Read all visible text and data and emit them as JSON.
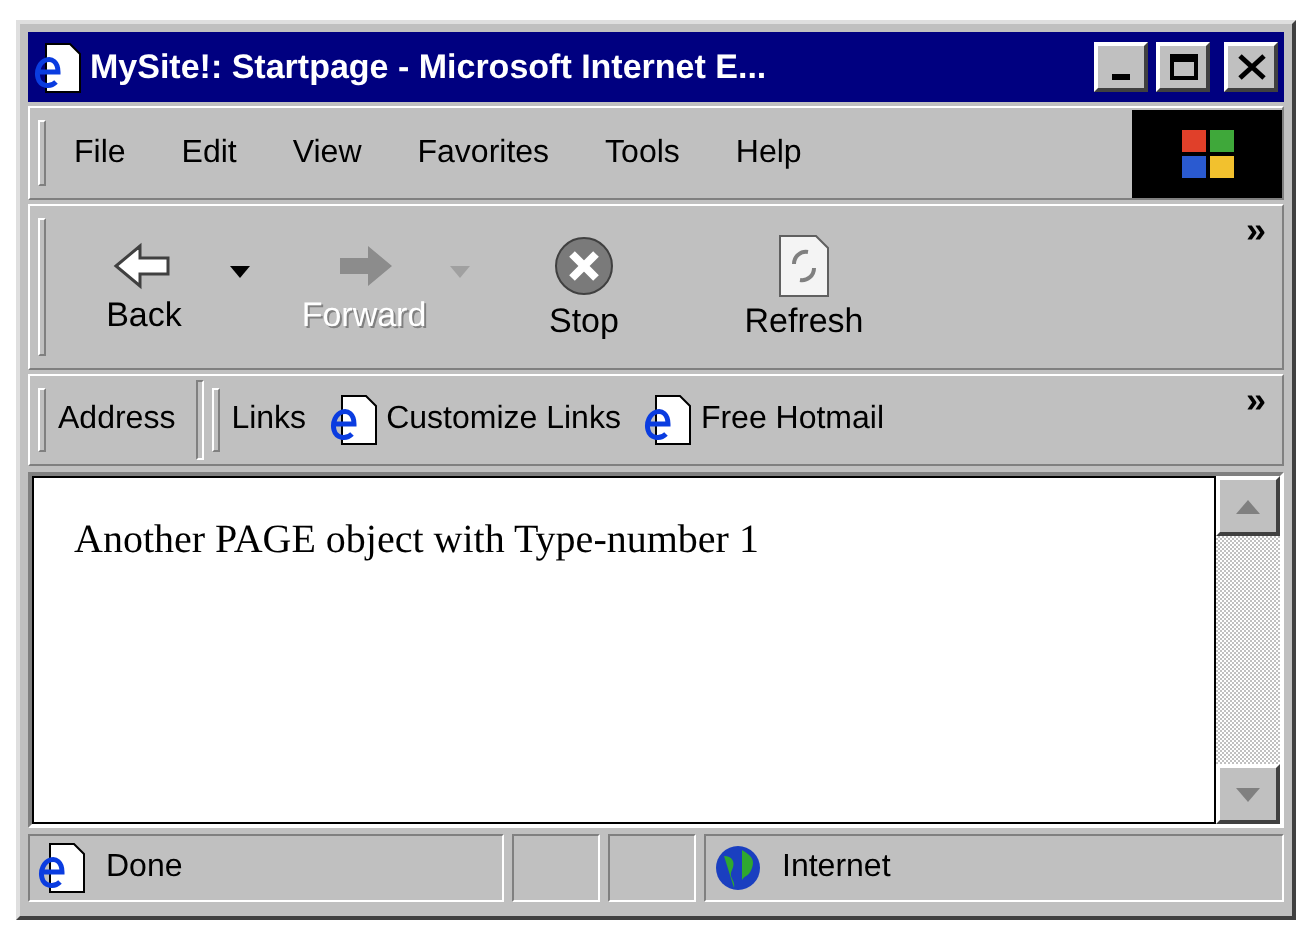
{
  "window": {
    "title": "MySite!: Startpage - Microsoft Internet E..."
  },
  "menu": [
    "File",
    "Edit",
    "View",
    "Favorites",
    "Tools",
    "Help"
  ],
  "toolbar": [
    {
      "label": "Back",
      "kind": "back",
      "disabled": false,
      "dropdown": true
    },
    {
      "label": "Forward",
      "kind": "forward",
      "disabled": true,
      "dropdown": true
    },
    {
      "label": "Stop",
      "kind": "stop",
      "disabled": false
    },
    {
      "label": "Refresh",
      "kind": "refresh",
      "disabled": false
    }
  ],
  "chevron": "»",
  "address": {
    "label": "Address"
  },
  "links": {
    "label": "Links",
    "items": [
      "Customize Links",
      "Free Hotmail"
    ],
    "chevron": "»"
  },
  "page": {
    "text": "Another PAGE object with Type-number 1"
  },
  "status_bar": {
    "text": "Done",
    "zone": "Internet"
  }
}
